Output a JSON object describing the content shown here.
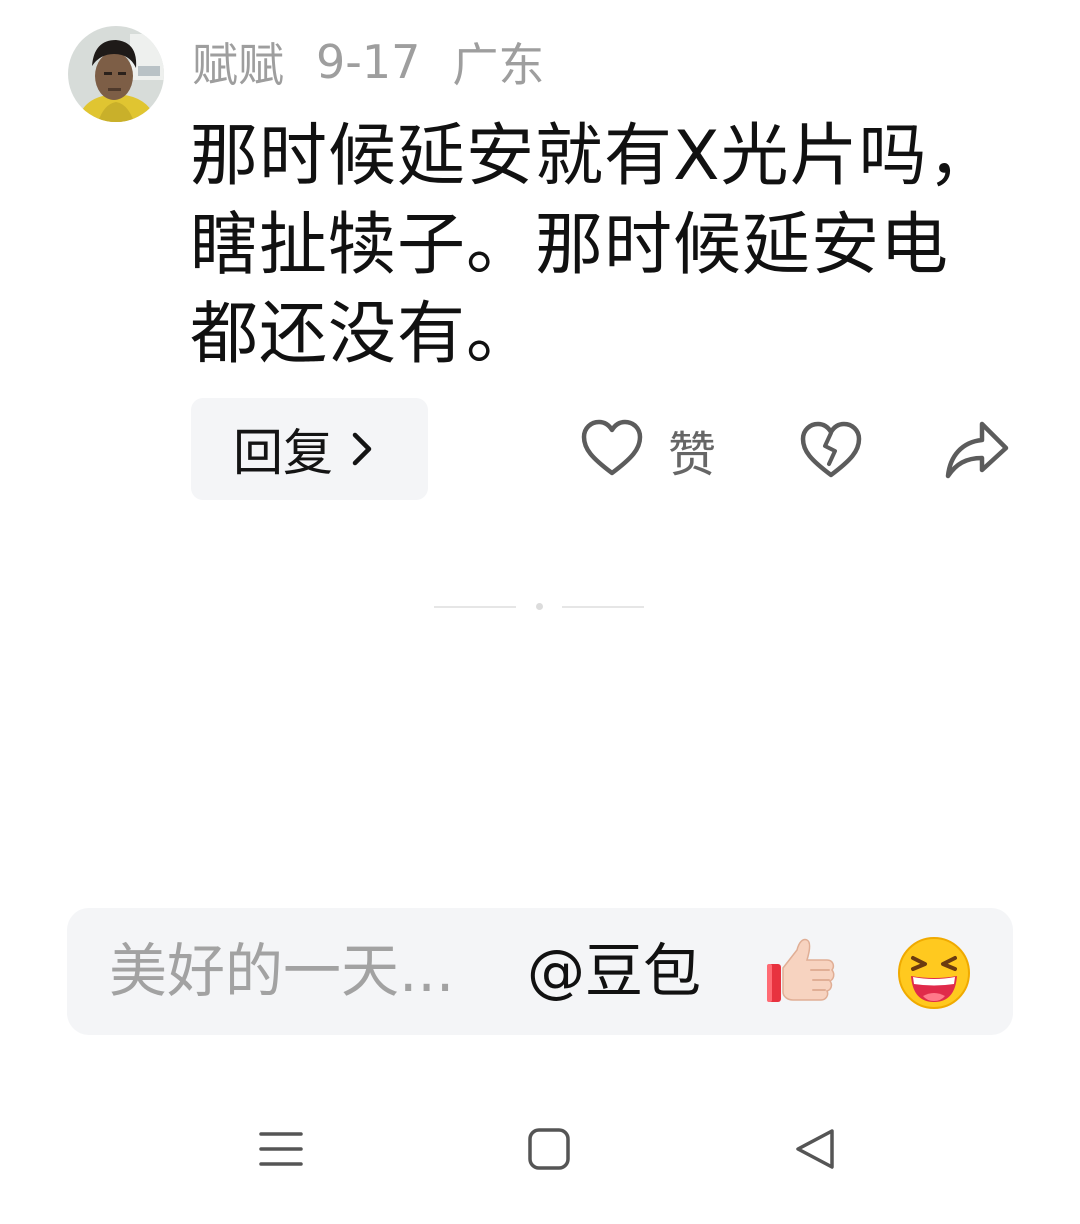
{
  "comment": {
    "author": "赋赋",
    "date": "9-17",
    "location": "广东",
    "text": "那时候延安就有X光片吗，瞎扯犊子。那时候延安电都还没有。",
    "avatar_icon": "user-photo-avatar"
  },
  "actions": {
    "reply_label": "回复",
    "reply_icon": "chevron-right-icon",
    "like_label": "赞",
    "like_icon": "heart-outline-icon",
    "dislike_icon": "broken-heart-icon",
    "share_icon": "share-arrow-icon"
  },
  "input": {
    "placeholder": "美好的一天...",
    "mention_label": "@豆包",
    "emoji_1": "thumbs-up-emoji",
    "emoji_2": "laughing-face-emoji"
  },
  "system_nav": {
    "menu_icon": "menu-icon",
    "home_icon": "square-home-icon",
    "back_icon": "triangle-back-icon"
  },
  "colors": {
    "meta_text": "#9e9e9e",
    "body_text": "#111111",
    "button_bg": "#f4f5f7",
    "icon_gray": "#5c5c5c"
  }
}
